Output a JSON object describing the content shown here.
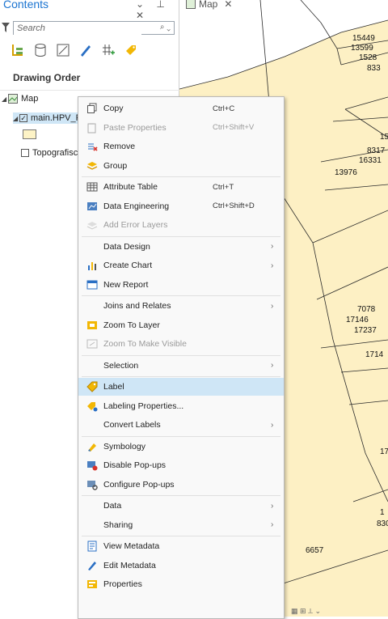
{
  "contents": {
    "title": "Contents",
    "pane_controls": "⌄ ⊥ ✕",
    "search_placeholder": "Search",
    "drawing_order": "Drawing Order",
    "map_label": "Map",
    "layer_label": "main.HPV_P",
    "layer2_label": "Topografisc"
  },
  "map": {
    "tab_label": "Map",
    "labels": [
      "15449",
      "13599",
      "1528",
      "833",
      "15",
      "8317",
      "16331",
      "13976",
      "7078",
      "17146",
      "17237",
      "1714",
      "17",
      "1",
      "830",
      "6657"
    ]
  },
  "menu": {
    "items": [
      {
        "label": "Copy",
        "shortcut": "Ctrl+C",
        "icon": "copy-icon"
      },
      {
        "label": "Paste Properties",
        "shortcut": "Ctrl+Shift+V",
        "icon": "paste-properties-icon",
        "disabled": true
      },
      {
        "label": "Remove",
        "shortcut": "",
        "icon": "remove-icon"
      },
      {
        "label": "Group",
        "shortcut": "",
        "icon": "group-icon"
      },
      {
        "label": "Attribute Table",
        "shortcut": "Ctrl+T",
        "icon": "attribute-table-icon"
      },
      {
        "label": "Data Engineering",
        "shortcut": "Ctrl+Shift+D",
        "icon": "data-engineering-icon"
      },
      {
        "label": "Add Error Layers",
        "shortcut": "",
        "icon": "add-error-layers-icon",
        "disabled": true
      },
      {
        "label": "Data Design",
        "shortcut": "",
        "icon": "",
        "submenu": true
      },
      {
        "label": "Create Chart",
        "shortcut": "",
        "icon": "chart-icon",
        "submenu": true
      },
      {
        "label": "New Report",
        "shortcut": "",
        "icon": "report-icon"
      },
      {
        "label": "Joins and Relates",
        "shortcut": "",
        "icon": "",
        "submenu": true
      },
      {
        "label": "Zoom To Layer",
        "shortcut": "",
        "icon": "zoom-to-layer-icon"
      },
      {
        "label": "Zoom To Make Visible",
        "shortcut": "",
        "icon": "zoom-to-visible-icon",
        "disabled": true
      },
      {
        "label": "Selection",
        "shortcut": "",
        "icon": "",
        "submenu": true
      },
      {
        "label": "Label",
        "shortcut": "",
        "icon": "label-icon",
        "selected": true
      },
      {
        "label": "Labeling Properties...",
        "shortcut": "",
        "icon": "labeling-properties-icon"
      },
      {
        "label": "Convert Labels",
        "shortcut": "",
        "icon": "",
        "submenu": true
      },
      {
        "label": "Symbology",
        "shortcut": "",
        "icon": "symbology-icon"
      },
      {
        "label": "Disable Pop-ups",
        "shortcut": "",
        "icon": "disable-popups-icon"
      },
      {
        "label": "Configure Pop-ups",
        "shortcut": "",
        "icon": "configure-popups-icon"
      },
      {
        "label": "Data",
        "shortcut": "",
        "icon": "",
        "submenu": true
      },
      {
        "label": "Sharing",
        "shortcut": "",
        "icon": "",
        "submenu": true
      },
      {
        "label": "View Metadata",
        "shortcut": "",
        "icon": "view-metadata-icon"
      },
      {
        "label": "Edit Metadata",
        "shortcut": "",
        "icon": "edit-metadata-icon"
      },
      {
        "label": "Properties",
        "shortcut": "",
        "icon": "properties-icon"
      }
    ]
  },
  "colors": {
    "accent": "#1b74d1",
    "parcel_fill": "#fdf0c4",
    "menu_bg": "#f9f9f9",
    "menu_selected": "#cfe6f6"
  }
}
